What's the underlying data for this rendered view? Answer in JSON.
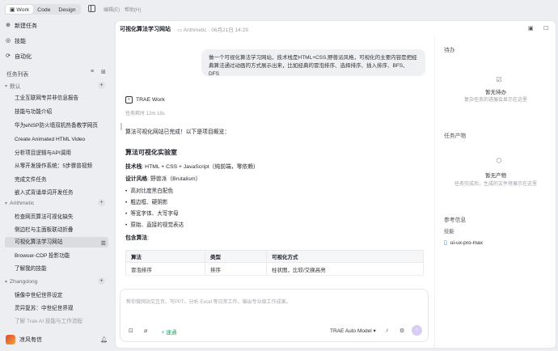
{
  "top_tabs": [
    "Work",
    "Code",
    "Design"
  ],
  "menu": [
    "编辑(E)",
    "帮助(H)"
  ],
  "nav": [
    {
      "icon": "new-task-icon",
      "label": "新建任务"
    },
    {
      "icon": "skill-icon",
      "label": "技能"
    },
    {
      "icon": "automation-icon",
      "label": "自动化"
    }
  ],
  "task_list_title": "任务列表",
  "groups": [
    {
      "name": "默认",
      "items": [
        "工业互联网专并非信息报告",
        "技能与功能介绍",
        "华为eNSP防火墙双机热备教学网页",
        "Create Animated HTML Video",
        "分析项目逻辑与API调用",
        "从零开发操作系统：5步骤普视频",
        "完成文件任务",
        "嵌入式背诵单词开发任务"
      ]
    },
    {
      "name": "Arithmetic",
      "items": [
        "检查网页算法可视化缺失",
        "侧边栏与主面板联动折叠",
        "可视化算法学习网站",
        "Browser-CDP 投影功能",
        "了解我的技能"
      ]
    },
    {
      "name": "Zhangdong",
      "items": [
        "镜像中世纪世界设定",
        "灵异复苏：中世纪世界观",
        "了解 Trae AI 技能与工作流程"
      ]
    }
  ],
  "user": {
    "name": "凉风有信"
  },
  "header": {
    "title": "可视化算法学习网站",
    "project": "Arithmetic",
    "date": "06月21日 14:29"
  },
  "user_message": "做一个可视化算法学习网站，技术栈是HTML+CSS,野兽派风格，可视化的主要内容是把经典算法通过动画的方式展示出来，比如经典的冒泡排序、选择排序、插入排序、BFS、DFS",
  "agent": {
    "name": "TRAE Work",
    "elapsed": "任务耗时 12m 18s"
  },
  "response": {
    "intro": "算法可视化网站已完成！以下是项目概览：",
    "heading": "算法可视化实验室",
    "tech_label": "技术栈",
    "tech_value": ": HTML + CSS + JavaScript（纯前端，零依赖）",
    "style_label": "设计风格",
    "style_value": ": 野兽派（Brutalism）",
    "bullets": [
      "高对比度黑白配色",
      "粗边框、硬阴影",
      "等宽字体、大写字母",
      "原始、直接的视觉表达"
    ],
    "includes_label": "包含算法",
    "includes_colon": ":",
    "table": {
      "headers": [
        "算法",
        "类型",
        "可视化方式"
      ],
      "rows": [
        [
          "冒泡排序",
          "排序",
          "柱状图，比较/交换高亮"
        ]
      ]
    }
  },
  "composer": {
    "placeholder": "帮你做网站交互页、写PPT、分析 Excel 等日常工作，输出专业级工作成果。",
    "fast_label": "速通",
    "model": "TRAE Auto Model"
  },
  "right_panel": {
    "todo_title": "待办",
    "todo_empty": "暂无待办",
    "todo_hint": "复杂任务的进展会显示在这里",
    "output_title": "任务产物",
    "output_empty": "暂无产物",
    "output_hint": "任务完成后，生成的文件将展示在这里",
    "ref_title": "参考信息",
    "skill_label": "技能",
    "skill_name": "ui-ux-pro-max"
  }
}
